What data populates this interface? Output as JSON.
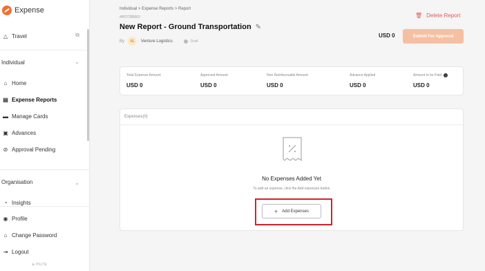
{
  "app": {
    "name": "Expense"
  },
  "sidebar": {
    "travel": {
      "label": "Travel"
    },
    "individual": {
      "label": "Individual"
    },
    "items": [
      {
        "label": "Home",
        "icon": "home-icon"
      },
      {
        "label": "Expense Reports",
        "icon": "report-icon"
      },
      {
        "label": "Manage Cards",
        "icon": "card-icon"
      },
      {
        "label": "Advances",
        "icon": "advance-icon"
      },
      {
        "label": "Approval Pending",
        "icon": "check-circle-icon"
      }
    ],
    "organisation": {
      "label": "Organisation"
    },
    "insights": {
      "label": "Insights"
    },
    "bottom": [
      {
        "label": "Profile",
        "icon": "profile-icon"
      },
      {
        "label": "Change Password",
        "icon": "lock-icon"
      },
      {
        "label": "Logout",
        "icon": "logout-icon"
      }
    ],
    "footer": "ITILITE"
  },
  "header": {
    "breadcrumb": "Individual  >  Expense Reports  >  Report",
    "report_id": "#RO7285663",
    "title": "New Report - Ground Transportation",
    "by_label": "By",
    "avatar_initials": "VL",
    "company": "Venture Logistics",
    "status": "Draft",
    "delete_label": "Delete Report",
    "currency_total": "USD 0",
    "submit_label": "Submit For Approval"
  },
  "summary": [
    {
      "label": "Total Expense Amount",
      "value": "USD 0"
    },
    {
      "label": "Approved Amount",
      "value": "USD 0"
    },
    {
      "label": "Non Reimbursable Amount",
      "value": "USD 0"
    },
    {
      "label": "Advance Applied",
      "value": "USD 0"
    },
    {
      "label": "Amount to be Paid",
      "value": "USD 0"
    }
  ],
  "expenses": {
    "header": "Expenses(0)",
    "empty_title": "No Expenses Added Yet",
    "empty_sub": "To add an expense, click the Add expenses button",
    "add_label": "Add Expenses"
  },
  "colors": {
    "accent": "#f07032",
    "danger": "#e05a5a",
    "highlight": "#d2202b"
  }
}
